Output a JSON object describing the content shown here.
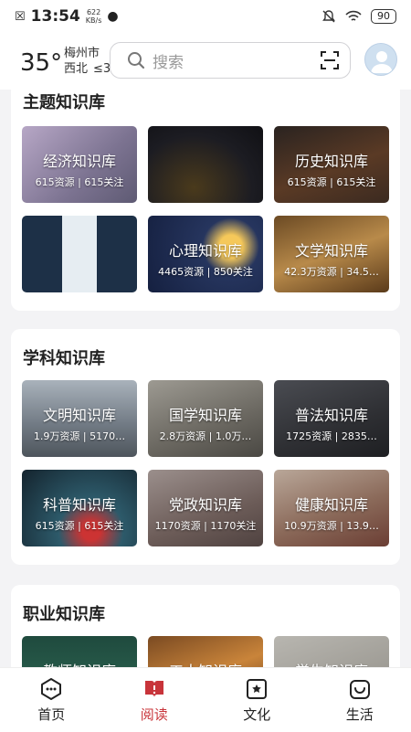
{
  "status_bar": {
    "time": "13:54",
    "speed_value": "622",
    "speed_unit": "KB/s",
    "battery": "90"
  },
  "header": {
    "temperature": "35°",
    "city": "梅州市",
    "wind": "西北",
    "aqi": "≤3",
    "search_placeholder": "搜索"
  },
  "sections": [
    {
      "title": "主题知识库",
      "tiles": [
        {
          "name": "经济知识库",
          "stats": "615资源 | 615关注"
        },
        {
          "name": "",
          "stats": ""
        },
        {
          "name": "历史知识库",
          "stats": "615资源 | 615关注"
        },
        {
          "name": "",
          "stats": ""
        },
        {
          "name": "心理知识库",
          "stats": "4465资源 | 850关注"
        },
        {
          "name": "文学知识库",
          "stats": "42.3万资源 | 34.5…"
        }
      ]
    },
    {
      "title": "学科知识库",
      "tiles": [
        {
          "name": "文明知识库",
          "stats": "1.9万资源 | 5170…"
        },
        {
          "name": "国学知识库",
          "stats": "2.8万资源 | 1.0万…"
        },
        {
          "name": "普法知识库",
          "stats": "1725资源 | 2835…"
        },
        {
          "name": "科普知识库",
          "stats": "615资源 | 615关注"
        },
        {
          "name": "党政知识库",
          "stats": "1170资源 | 1170关注"
        },
        {
          "name": "健康知识库",
          "stats": "10.9万资源 | 13.9…"
        }
      ]
    },
    {
      "title": "职业知识库",
      "tiles": [
        {
          "name": "教师知识库",
          "stats": ""
        },
        {
          "name": "工人知识库",
          "stats": ""
        },
        {
          "name": "学生知识库",
          "stats": ""
        }
      ]
    }
  ],
  "nav": [
    {
      "label": "首页",
      "icon": "home-icon",
      "active": false
    },
    {
      "label": "阅读",
      "icon": "book-icon",
      "active": true
    },
    {
      "label": "文化",
      "icon": "culture-icon",
      "active": false
    },
    {
      "label": "生活",
      "icon": "life-icon",
      "active": false
    }
  ],
  "colors": {
    "accent": "#c8343a"
  }
}
